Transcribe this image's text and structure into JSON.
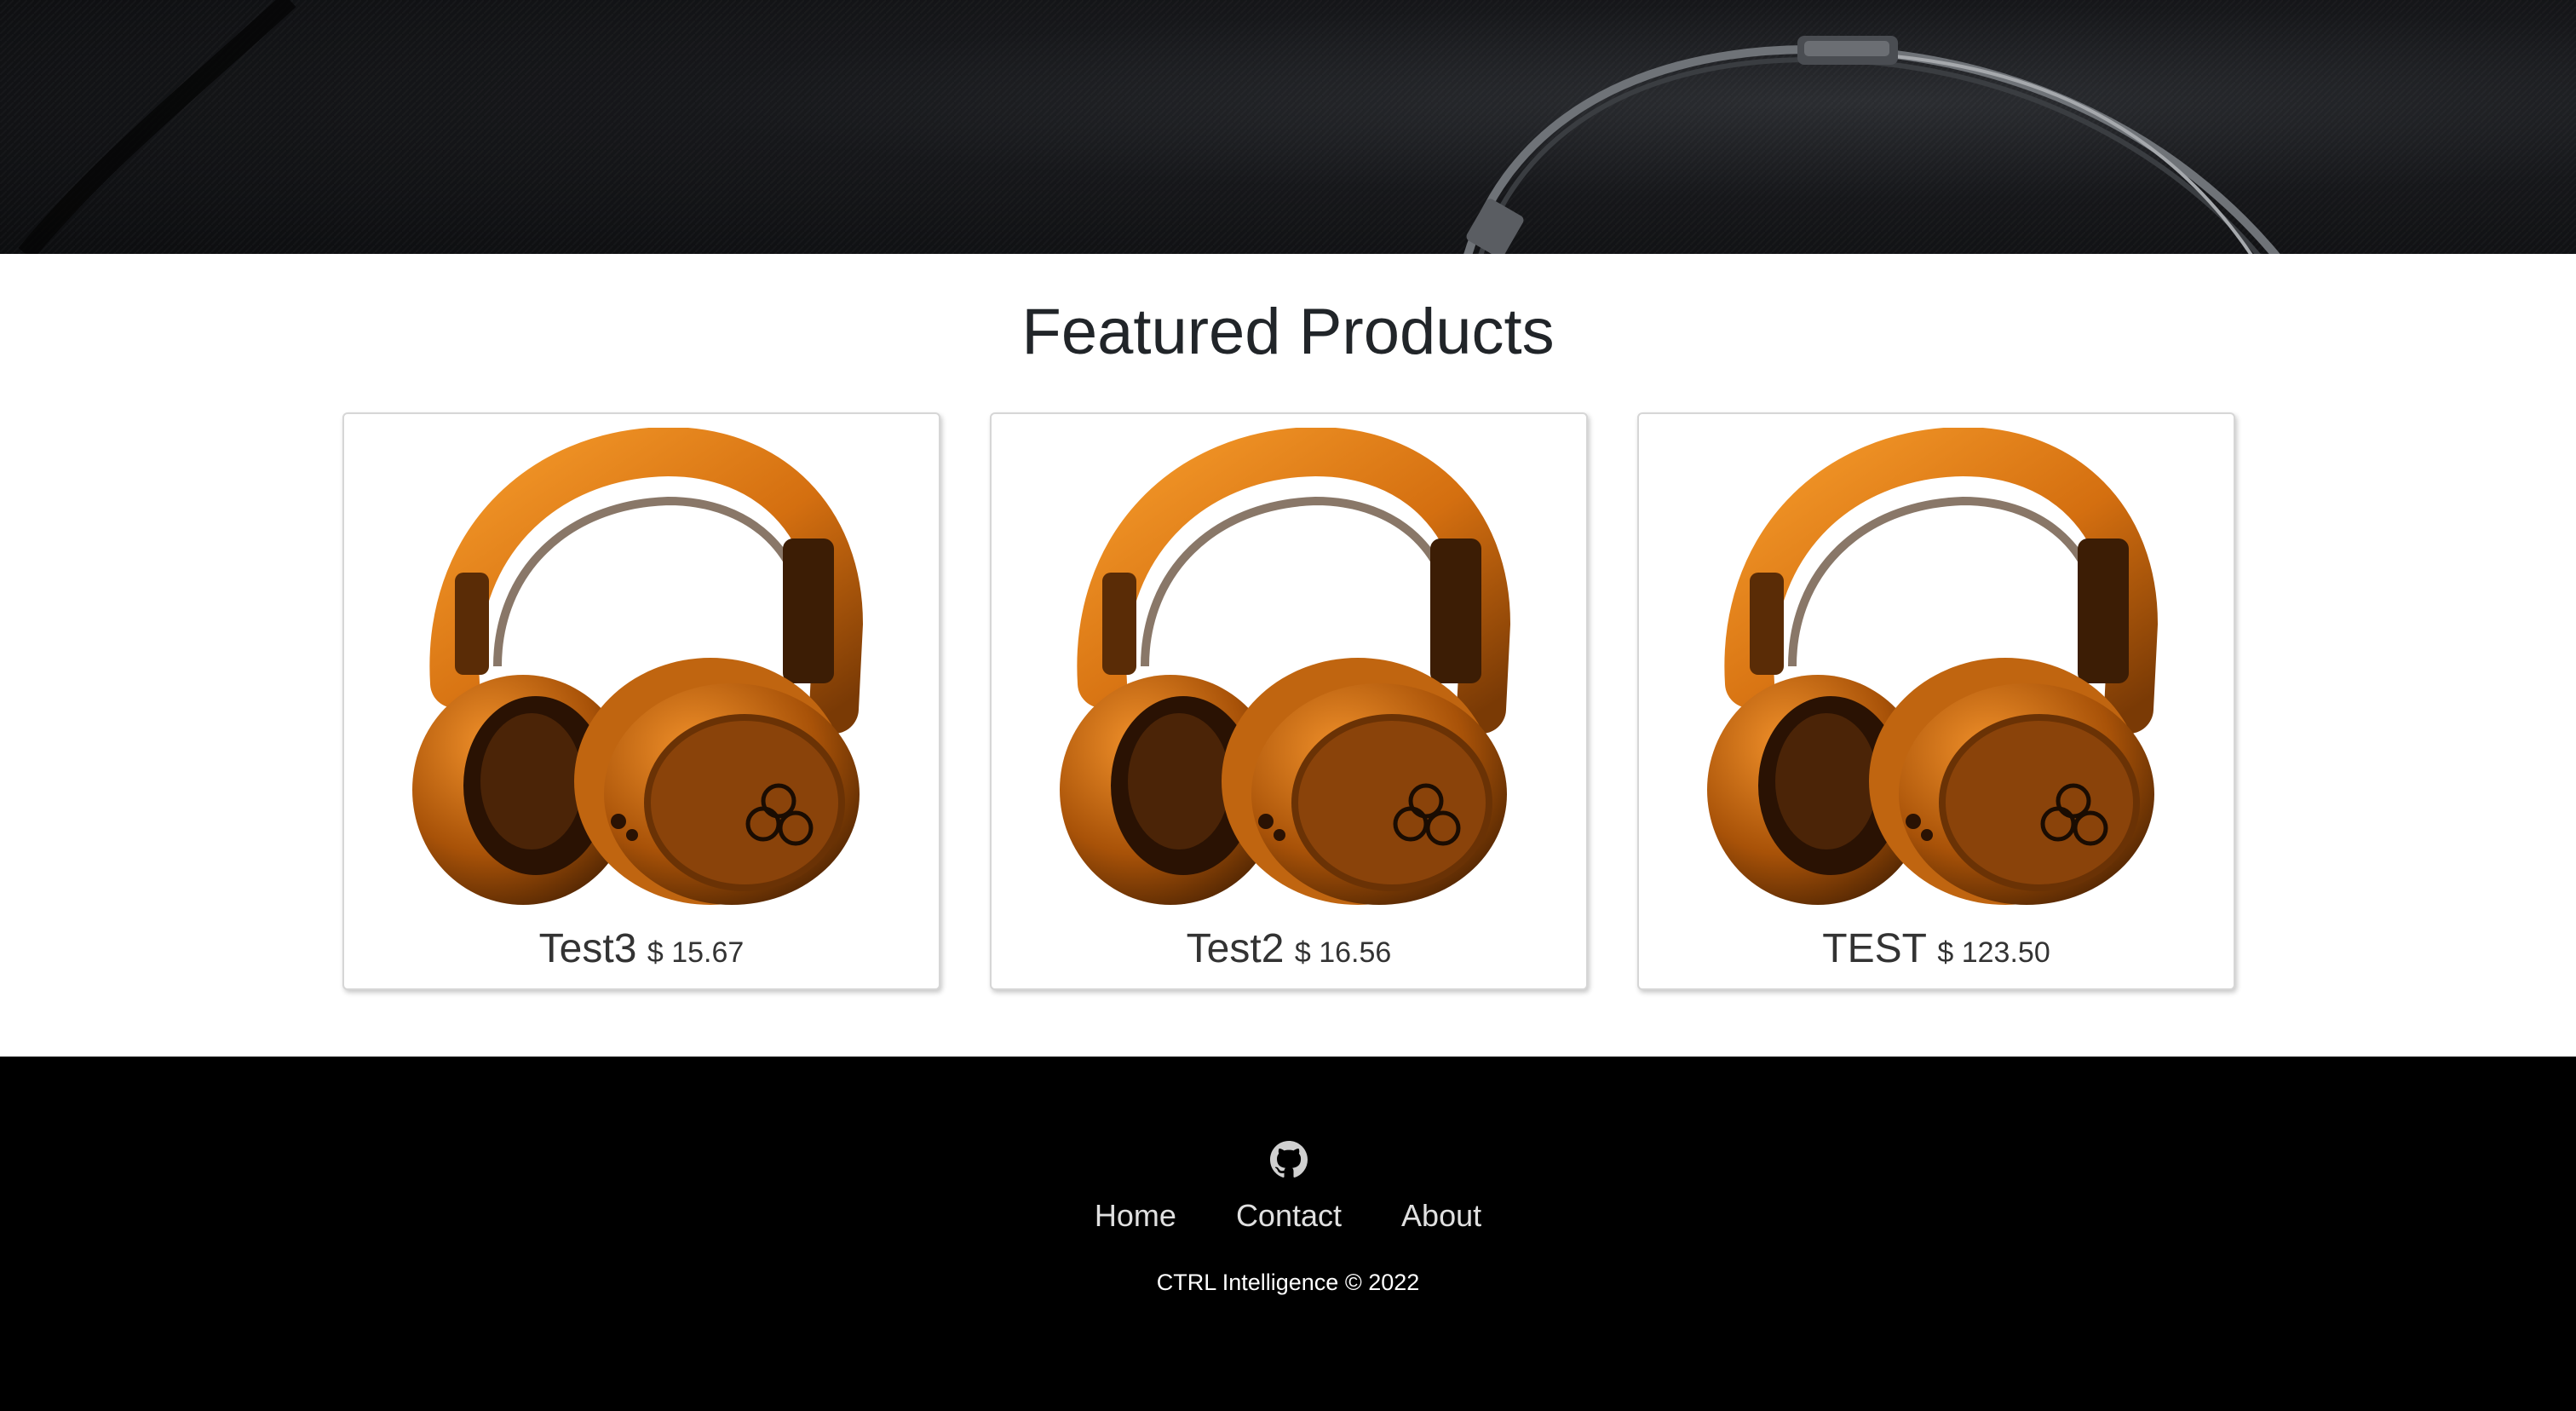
{
  "featured": {
    "title": "Featured Products"
  },
  "products": [
    {
      "name": "Test3",
      "price": "$ 15.67"
    },
    {
      "name": "Test2",
      "price": "$ 16.56"
    },
    {
      "name": "TEST",
      "price": "$ 123.50"
    }
  ],
  "footer": {
    "icon": "github-icon",
    "nav": [
      "Home",
      "Contact",
      "About"
    ],
    "copyright": "CTRL Intelligence © 2022"
  },
  "colors": {
    "hero_background": "#141518",
    "footer_background": "#000000",
    "product_orange": "#e8821a",
    "title_text": "#212529"
  }
}
